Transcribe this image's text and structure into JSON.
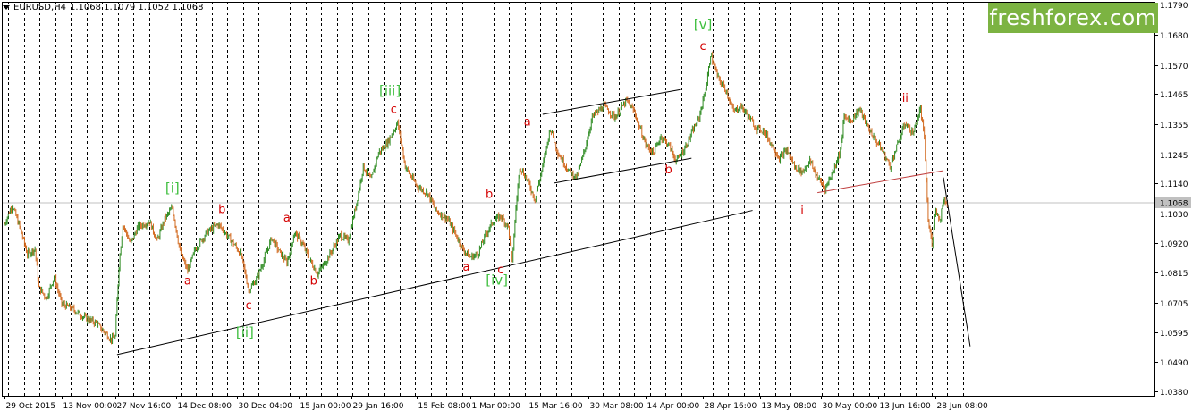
{
  "header": {
    "symbol": "EURUSD,H4",
    "ohlc": "1.1068 1.1079 1.1052 1.1068"
  },
  "logo": {
    "text": "freshforex.com",
    "color": "#7cb342"
  },
  "colors": {
    "bull": "#2e8b22",
    "bear": "#d2691e",
    "wave_green": "#3fbf3f",
    "wave_red": "#d40000",
    "grid": "#000000",
    "price_tag": "#c0c0c0"
  },
  "chart_data": {
    "type": "candlestick",
    "symbol": "EURUSD",
    "timeframe": "H4",
    "ylim": [
      1.0365,
      1.18
    ],
    "current_price": 1.1068,
    "y_ticks": [
      1.179,
      1.168,
      1.157,
      1.1465,
      1.1355,
      1.1245,
      1.114,
      1.103,
      1.092,
      1.0815,
      1.0705,
      1.0595,
      1.049,
      1.038
    ],
    "x_ticks": [
      {
        "label": "29 Oct 2015",
        "t": 0
      },
      {
        "label": "13 Nov 00:00",
        "t": 15
      },
      {
        "label": "27 Nov 16:00",
        "t": 29
      },
      {
        "label": "14 Dec 08:00",
        "t": 45
      },
      {
        "label": "30 Dec 04:00",
        "t": 61
      },
      {
        "label": "15 Jan 00:00",
        "t": 77
      },
      {
        "label": "29 Jan 16:00",
        "t": 91
      },
      {
        "label": "15 Feb 08:00",
        "t": 108
      },
      {
        "label": "1 Mar 00:00",
        "t": 122
      },
      {
        "label": "15 Mar 16:00",
        "t": 137
      },
      {
        "label": "30 Mar 08:00",
        "t": 153
      },
      {
        "label": "14 Apr 00:00",
        "t": 168
      },
      {
        "label": "28 Apr 16:00",
        "t": 183
      },
      {
        "label": "13 May 08:00",
        "t": 198
      },
      {
        "label": "30 May 00:00",
        "t": 214
      },
      {
        "label": "13 Jun 16:00",
        "t": 229
      },
      {
        "label": "28 Jun 08:00",
        "t": 244
      }
    ],
    "price_path": [
      [
        0,
        1.099
      ],
      [
        2,
        1.106
      ],
      [
        4,
        1.098
      ],
      [
        6,
        1.088
      ],
      [
        8,
        1.09
      ],
      [
        9,
        1.076
      ],
      [
        11,
        1.072
      ],
      [
        13,
        1.08
      ],
      [
        15,
        1.07
      ],
      [
        18,
        1.068
      ],
      [
        21,
        1.065
      ],
      [
        24,
        1.063
      ],
      [
        26,
        1.06
      ],
      [
        28,
        1.057
      ],
      [
        29,
        1.058
      ],
      [
        30,
        1.084
      ],
      [
        31,
        1.099
      ],
      [
        33,
        1.092
      ],
      [
        35,
        1.098
      ],
      [
        38,
        1.1
      ],
      [
        40,
        1.093
      ],
      [
        42,
        1.101
      ],
      [
        44,
        1.105
      ],
      [
        46,
        1.089
      ],
      [
        48,
        1.082
      ],
      [
        50,
        1.09
      ],
      [
        53,
        1.096
      ],
      [
        56,
        1.099
      ],
      [
        60,
        1.092
      ],
      [
        62,
        1.088
      ],
      [
        64,
        1.075
      ],
      [
        66,
        1.079
      ],
      [
        68,
        1.086
      ],
      [
        70,
        1.094
      ],
      [
        72,
        1.089
      ],
      [
        74,
        1.085
      ],
      [
        76,
        1.096
      ],
      [
        78,
        1.092
      ],
      [
        80,
        1.086
      ],
      [
        82,
        1.081
      ],
      [
        84,
        1.085
      ],
      [
        86,
        1.09
      ],
      [
        88,
        1.095
      ],
      [
        90,
        1.093
      ],
      [
        92,
        1.105
      ],
      [
        94,
        1.12
      ],
      [
        96,
        1.115
      ],
      [
        98,
        1.125
      ],
      [
        100,
        1.128
      ],
      [
        102,
        1.133
      ],
      [
        103,
        1.136
      ],
      [
        105,
        1.12
      ],
      [
        108,
        1.113
      ],
      [
        111,
        1.11
      ],
      [
        113,
        1.104
      ],
      [
        116,
        1.101
      ],
      [
        118,
        1.096
      ],
      [
        120,
        1.09
      ],
      [
        122,
        1.087
      ],
      [
        124,
        1.088
      ],
      [
        126,
        1.095
      ],
      [
        128,
        1.1
      ],
      [
        130,
        1.102
      ],
      [
        132,
        1.098
      ],
      [
        133,
        1.085
      ],
      [
        134,
        1.105
      ],
      [
        135,
        1.12
      ],
      [
        137,
        1.115
      ],
      [
        139,
        1.108
      ],
      [
        141,
        1.12
      ],
      [
        143,
        1.134
      ],
      [
        145,
        1.125
      ],
      [
        148,
        1.118
      ],
      [
        150,
        1.116
      ],
      [
        152,
        1.126
      ],
      [
        154,
        1.138
      ],
      [
        157,
        1.142
      ],
      [
        160,
        1.138
      ],
      [
        163,
        1.144
      ],
      [
        165,
        1.14
      ],
      [
        168,
        1.128
      ],
      [
        170,
        1.125
      ],
      [
        172,
        1.131
      ],
      [
        174,
        1.128
      ],
      [
        176,
        1.122
      ],
      [
        178,
        1.126
      ],
      [
        180,
        1.132
      ],
      [
        182,
        1.138
      ],
      [
        184,
        1.15
      ],
      [
        185,
        1.161
      ],
      [
        187,
        1.152
      ],
      [
        189,
        1.148
      ],
      [
        191,
        1.14
      ],
      [
        193,
        1.142
      ],
      [
        195,
        1.138
      ],
      [
        197,
        1.134
      ],
      [
        199,
        1.133
      ],
      [
        201,
        1.128
      ],
      [
        203,
        1.123
      ],
      [
        205,
        1.126
      ],
      [
        207,
        1.12
      ],
      [
        209,
        1.118
      ],
      [
        211,
        1.122
      ],
      [
        213,
        1.116
      ],
      [
        215,
        1.112
      ],
      [
        217,
        1.118
      ],
      [
        219,
        1.126
      ],
      [
        220,
        1.138
      ],
      [
        222,
        1.137
      ],
      [
        224,
        1.141
      ],
      [
        226,
        1.135
      ],
      [
        228,
        1.13
      ],
      [
        230,
        1.126
      ],
      [
        232,
        1.12
      ],
      [
        234,
        1.128
      ],
      [
        236,
        1.136
      ],
      [
        238,
        1.132
      ],
      [
        240,
        1.141
      ],
      [
        241,
        1.13
      ],
      [
        242,
        1.1
      ],
      [
        243,
        1.092
      ],
      [
        244,
        1.105
      ],
      [
        245,
        1.1
      ],
      [
        246,
        1.108
      ],
      [
        247,
        1.1068
      ]
    ],
    "trendlines": [
      {
        "from": [
          29.5,
          1.0515
        ],
        "to": [
          196,
          1.104
        ],
        "color": "#000000"
      },
      {
        "from": [
          141,
          1.139
        ],
        "to": [
          177,
          1.148
        ],
        "color": "#000000"
      },
      {
        "from": [
          144,
          1.114
        ],
        "to": [
          180,
          1.123
        ],
        "color": "#000000"
      },
      {
        "from": [
          213,
          1.1105
        ],
        "to": [
          246,
          1.1185
        ],
        "color": "#c04040"
      },
      {
        "from": [
          246,
          1.116
        ],
        "to": [
          253,
          1.0545
        ],
        "color": "#000000"
      }
    ],
    "wave_labels": [
      {
        "text": "[i]",
        "t": 44,
        "p": 1.1105,
        "color": "green"
      },
      {
        "text": "[ii]",
        "t": 63,
        "p": 1.058,
        "color": "green"
      },
      {
        "text": "[iii]",
        "t": 101,
        "p": 1.146,
        "color": "green"
      },
      {
        "text": "[iv]",
        "t": 129,
        "p": 1.077,
        "color": "green"
      },
      {
        "text": "[v]",
        "t": 183,
        "p": 1.17,
        "color": "green"
      },
      {
        "text": "a",
        "t": 48,
        "p": 1.077,
        "color": "red"
      },
      {
        "text": "b",
        "t": 57,
        "p": 1.103,
        "color": "red"
      },
      {
        "text": "c",
        "t": 64,
        "p": 1.068,
        "color": "red"
      },
      {
        "text": "a",
        "t": 74,
        "p": 1.1,
        "color": "red"
      },
      {
        "text": "b",
        "t": 81,
        "p": 1.077,
        "color": "red"
      },
      {
        "text": "c",
        "t": 102,
        "p": 1.1395,
        "color": "red"
      },
      {
        "text": "a",
        "t": 121,
        "p": 1.082,
        "color": "red"
      },
      {
        "text": "b",
        "t": 127,
        "p": 1.1085,
        "color": "red"
      },
      {
        "text": "c",
        "t": 130,
        "p": 1.081,
        "color": "red"
      },
      {
        "text": "a",
        "t": 137,
        "p": 1.135,
        "color": "red"
      },
      {
        "text": "b",
        "t": 174,
        "p": 1.1175,
        "color": "red"
      },
      {
        "text": "c",
        "t": 183,
        "p": 1.1625,
        "color": "red"
      },
      {
        "text": "i",
        "t": 209,
        "p": 1.1025,
        "color": "red"
      },
      {
        "text": "ii",
        "t": 236,
        "p": 1.1435,
        "color": "red"
      }
    ]
  }
}
